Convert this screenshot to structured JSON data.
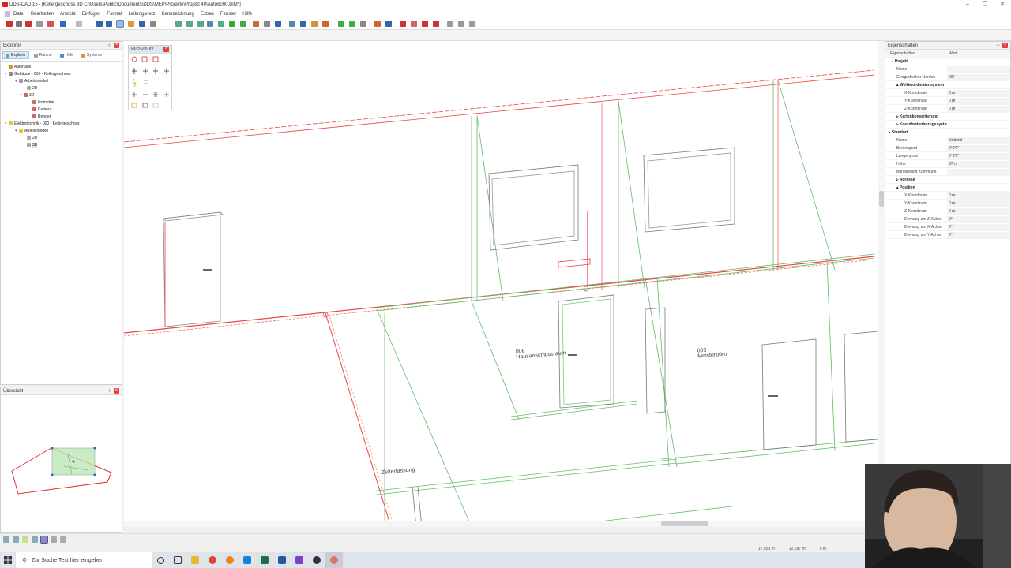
{
  "window": {
    "title": "DDS-CAD 15 - [Kellergeschoss 3D C:\\Users\\Public\\Documents\\DDS\\MEP\\Projekte\\Projekt 40\\Auto6000.BIM*]",
    "controls": [
      "–",
      "❐",
      "✕"
    ]
  },
  "menu": [
    "Datei",
    "Bearbeiten",
    "Ansicht",
    "Einfügen",
    "Format",
    "Leitungsnetz",
    "Kennzeichnung",
    "Extras",
    "Fenster",
    "Hilfe"
  ],
  "explorer": {
    "title": "Explorer",
    "tabs": [
      "Explorer",
      "Räume",
      "Hilfe",
      "Systeme"
    ],
    "tree": [
      {
        "label": "Autohaus",
        "level": 1,
        "exp": ""
      },
      {
        "label": "Gebäude - 000 - Kellergeschoss",
        "level": 1,
        "exp": "▾"
      },
      {
        "label": "Arbeitsmodell",
        "level": 2,
        "exp": "▾"
      },
      {
        "label": "2D",
        "level": 3,
        "exp": ""
      },
      {
        "label": "3D",
        "level": 3,
        "exp": "▾"
      },
      {
        "label": "Isometrie",
        "level": 4,
        "exp": ""
      },
      {
        "label": "Kamera",
        "level": 4,
        "exp": ""
      },
      {
        "label": "Render",
        "level": 4,
        "exp": ""
      },
      {
        "label": "Elektrotechnik - 000 - Kellergeschoss",
        "level": 1,
        "exp": "▾"
      },
      {
        "label": "Arbeitsmodell",
        "level": 2,
        "exp": "▾"
      },
      {
        "label": "2D",
        "level": 3,
        "exp": ""
      },
      {
        "label": "3D",
        "level": 3,
        "exp": "",
        "selected": true
      }
    ]
  },
  "overview": {
    "title": "Übersicht"
  },
  "blitzschutz": {
    "title": "Blitzschutz"
  },
  "properties": {
    "title": "Eigenschaften",
    "header_key": "Eigenschaften",
    "header_value": "Wert",
    "rows": [
      {
        "k": "▴ Projekt",
        "v": "",
        "grp": true
      },
      {
        "k": "Name",
        "v": ""
      },
      {
        "k": "Geografischer Norden",
        "v": "90°"
      },
      {
        "k": "▴ Weltkoordinatensystem",
        "v": "",
        "grp": true
      },
      {
        "k": "X-Koordinate",
        "v": "0 m"
      },
      {
        "k": "Y-Koordinate",
        "v": "0 m"
      },
      {
        "k": "Z-Koordinate",
        "v": "0 m"
      },
      {
        "k": "▹ Kartenkonvertierung",
        "v": "",
        "grp": true
      },
      {
        "k": "▹ Koordinatenbezugssystem",
        "v": "",
        "grp": true
      },
      {
        "k": "▴ Standort",
        "v": "",
        "grp": true
      },
      {
        "k": "Name",
        "v": "Nettetal"
      },
      {
        "k": "Breitengrad",
        "v": "0°0'0\""
      },
      {
        "k": "Längengrad",
        "v": "0°0'0\""
      },
      {
        "k": "Höhe",
        "v": "37 m"
      },
      {
        "k": "Bundesland Kommune",
        "v": ""
      },
      {
        "k": "▹ Adresse",
        "v": "",
        "grp": true
      },
      {
        "k": "▴ Position",
        "v": "",
        "grp": true
      },
      {
        "k": "X-Koordinate",
        "v": "0 m"
      },
      {
        "k": "Y-Koordinate",
        "v": "0 m"
      },
      {
        "k": "Z-Koordinate",
        "v": "0 m"
      },
      {
        "k": "Drehung um Z-Achse",
        "v": "0°"
      },
      {
        "k": "Drehung um X-Achse",
        "v": "0°"
      },
      {
        "k": "Drehung um Y-Achse",
        "v": "0°"
      }
    ]
  },
  "canvas": {
    "room_labels": [
      {
        "num": "006",
        "name": "Hausanschlussraum"
      },
      {
        "num": "003",
        "name": "Meisterbüro"
      },
      {
        "num": "",
        "name": "Zeiterfassung"
      }
    ]
  },
  "status": {
    "readouts": [
      "17,553 m",
      "12,687 m",
      "0 m"
    ]
  },
  "taskbar": {
    "search_placeholder": "Zur Suche Text hier eingeben"
  }
}
